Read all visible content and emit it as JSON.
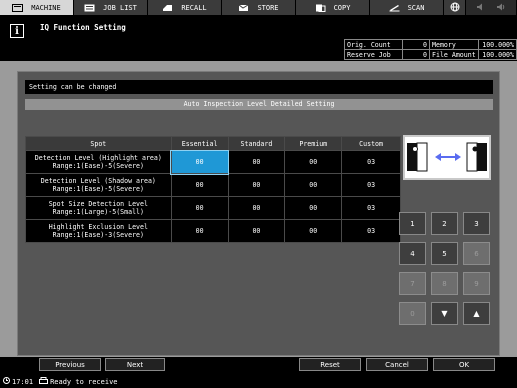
{
  "tabs": [
    {
      "label": "MACHINE",
      "icon": "machine-icon",
      "active": true
    },
    {
      "label": "JOB LIST",
      "icon": "job-list-icon",
      "active": false
    },
    {
      "label": "RECALL",
      "icon": "recall-icon",
      "active": false
    },
    {
      "label": "STORE",
      "icon": "store-icon",
      "active": false
    },
    {
      "label": "COPY",
      "icon": "copy-icon",
      "active": false
    },
    {
      "label": "SCAN",
      "icon": "scan-icon",
      "active": false
    }
  ],
  "header": {
    "title": "IQ Function Setting",
    "status": [
      {
        "label": "Orig. Count",
        "value": "0",
        "label2": "Memory",
        "value2": "100.000%"
      },
      {
        "label": "Reserve Job",
        "value": "0",
        "label2": "File Amount",
        "value2": "100.000%"
      }
    ]
  },
  "message": "Setting can be changed",
  "subtitle": "Auto Inspection Level Detailed Setting",
  "table": {
    "headers": [
      "Spot",
      "Essential",
      "Standard",
      "Premium",
      "Custom"
    ],
    "rows": [
      {
        "label1": "Detection Level (Highlight area)",
        "label2": "Range:1(Ease)-5(Severe)",
        "values": [
          "00",
          "00",
          "00",
          "03"
        ]
      },
      {
        "label1": "Detection Level (Shadow area)",
        "label2": "Range:1(Ease)-5(Severe)",
        "values": [
          "00",
          "00",
          "00",
          "03"
        ]
      },
      {
        "label1": "Spot Size Detection Level",
        "label2": "Range:1(Large)-5(Small)",
        "values": [
          "00",
          "00",
          "00",
          "03"
        ]
      },
      {
        "label1": "Highlight Exclusion Level",
        "label2": "Range:1(Ease)-3(Severe)",
        "values": [
          "00",
          "00",
          "00",
          "03"
        ]
      }
    ]
  },
  "keypad": {
    "keys": [
      "1",
      "2",
      "3",
      "4",
      "5",
      "6",
      "7",
      "8",
      "9",
      "0",
      "▼",
      "▲"
    ]
  },
  "buttons": {
    "previous": "Previous",
    "next": "Next",
    "reset": "Reset",
    "cancel": "Cancel",
    "ok": "OK"
  },
  "footer": {
    "time": "17:01",
    "status": "Ready to receive"
  },
  "colors": {
    "selected_cell": "#1f98d6",
    "preview_arrow": "#5a6cf0"
  }
}
